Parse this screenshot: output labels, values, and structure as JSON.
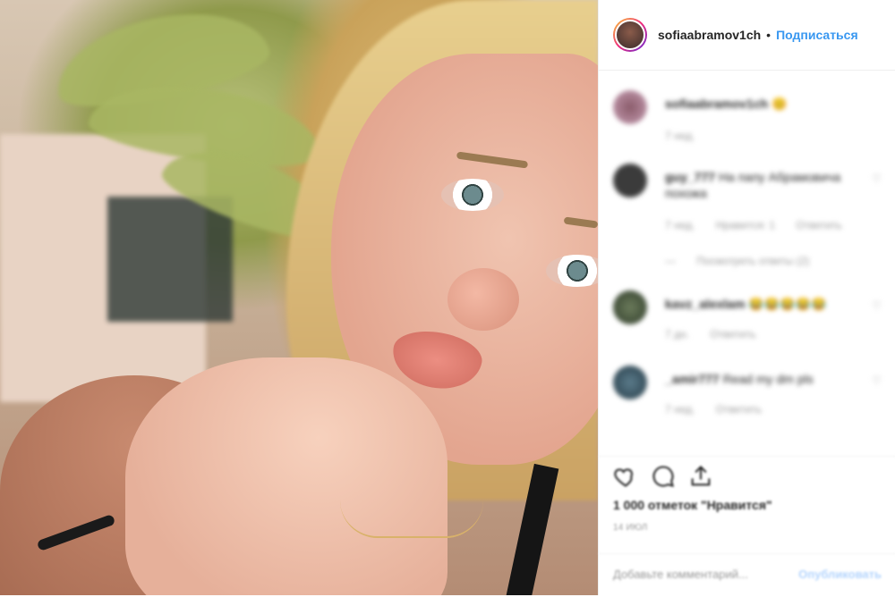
{
  "header": {
    "username": "sofiaabramov1ch",
    "separator": "•",
    "follow_label": "Подписаться"
  },
  "comments": [
    {
      "author": "sofiaabramov1ch",
      "text": "😊",
      "meta": [
        "7 нед."
      ]
    },
    {
      "author": "guy_777",
      "text": "На папу Абрамовича похожа",
      "meta": [
        "7 нед.",
        "Нравится: 1",
        "Ответить"
      ],
      "extra": "Посмотреть ответы (2)"
    },
    {
      "author": "kavz_alexlam",
      "text": "😂😂😂😂😂",
      "meta": [
        "7 дн.",
        "Ответить"
      ]
    },
    {
      "author": "_amir777",
      "text": "Read my dm pls",
      "meta": [
        "7 нед.",
        "Ответить"
      ]
    }
  ],
  "actions": {
    "likes": "1 000 отметок \"Нравится\"",
    "date": "14 ИЮЛ",
    "add_comment_placeholder": "Добавьте комментарий...",
    "post_label": "Опубликовать"
  },
  "colors": {
    "accent": "#3897f0",
    "text": "#262626",
    "muted": "#999999",
    "border": "#efefef"
  },
  "icons": [
    "heart-icon",
    "comment-icon",
    "share-icon",
    "bookmark-icon"
  ]
}
